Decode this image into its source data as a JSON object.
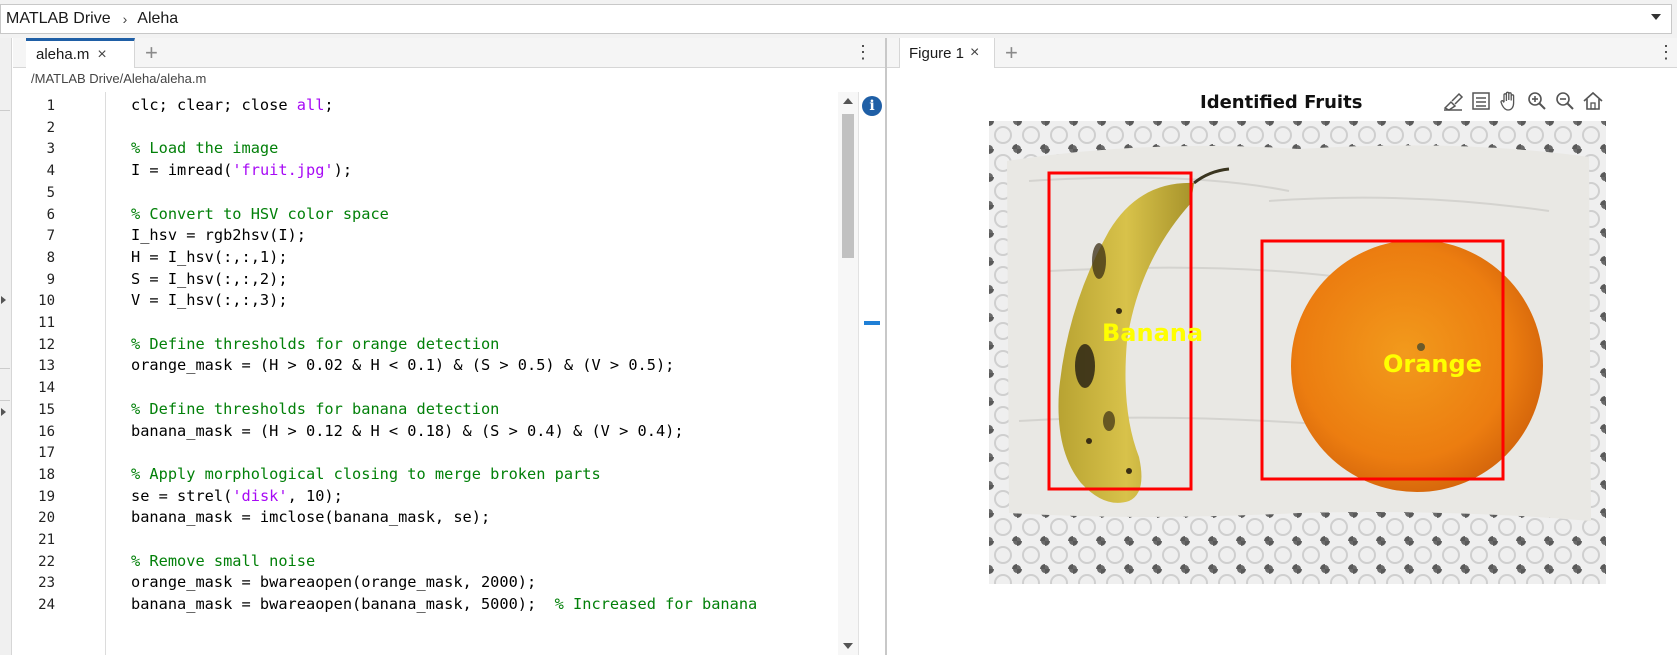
{
  "address_bar": {
    "segments": [
      "MATLAB Drive",
      "Aleha"
    ],
    "separator": "›"
  },
  "editor": {
    "tab_label": "aleha.m",
    "file_path": "/MATLAB Drive/Aleha/aleha.m",
    "line_numbers": [
      "1",
      "2",
      "3",
      "4",
      "5",
      "6",
      "7",
      "8",
      "9",
      "10",
      "11",
      "12",
      "13",
      "14",
      "15",
      "16",
      "17",
      "18",
      "19",
      "20",
      "21",
      "22",
      "23",
      "24"
    ],
    "lines": [
      [
        {
          "t": "clc; clear; close ",
          "c": ""
        },
        {
          "t": "all",
          "c": "kw"
        },
        {
          "t": ";",
          "c": ""
        }
      ],
      [],
      [
        {
          "t": "% Load the image",
          "c": "cm"
        }
      ],
      [
        {
          "t": "I = imread(",
          "c": ""
        },
        {
          "t": "'fruit.jpg'",
          "c": "str"
        },
        {
          "t": ");",
          "c": ""
        }
      ],
      [],
      [
        {
          "t": "% Convert to HSV color space",
          "c": "cm"
        }
      ],
      [
        {
          "t": "I_hsv = rgb2hsv(I);",
          "c": ""
        }
      ],
      [
        {
          "t": "H = I_hsv(:,:,1);",
          "c": ""
        }
      ],
      [
        {
          "t": "S = I_hsv(:,:,2);",
          "c": ""
        }
      ],
      [
        {
          "t": "V = I_hsv(:,:,3);",
          "c": ""
        }
      ],
      [],
      [
        {
          "t": "% Define thresholds for orange detection",
          "c": "cm"
        }
      ],
      [
        {
          "t": "orange_mask = (H > 0.02 & H < 0.1) & (S > 0.5) & (V > 0.5);",
          "c": ""
        }
      ],
      [],
      [
        {
          "t": "% Define thresholds for banana detection",
          "c": "cm"
        }
      ],
      [
        {
          "t": "banana_mask = (H > 0.12 & H < 0.18) & (S > 0.4) & (V > 0.4);",
          "c": ""
        }
      ],
      [],
      [
        {
          "t": "% Apply morphological closing to merge broken parts",
          "c": "cm"
        }
      ],
      [
        {
          "t": "se = strel(",
          "c": ""
        },
        {
          "t": "'disk'",
          "c": "str"
        },
        {
          "t": ", 10);",
          "c": ""
        }
      ],
      [
        {
          "t": "banana_mask = imclose(banana_mask, se);",
          "c": ""
        }
      ],
      [],
      [
        {
          "t": "% Remove small noise",
          "c": "cm"
        }
      ],
      [
        {
          "t": "orange_mask = bwareaopen(orange_mask, 2000);",
          "c": ""
        }
      ],
      [
        {
          "t": "banana_mask = bwareaopen(banana_mask, 5000);  ",
          "c": ""
        },
        {
          "t": "% Increased for banana",
          "c": "cm"
        }
      ]
    ]
  },
  "figure": {
    "tab_label": "Figure 1",
    "title": "Identified Fruits",
    "toolbar_icons": [
      "brush-icon",
      "legend-icon",
      "pan-hand-icon",
      "zoom-in-icon",
      "zoom-out-icon",
      "home-icon"
    ],
    "labels": {
      "banana": "Banana",
      "orange": "Orange"
    },
    "box_color": "#ff0000",
    "label_color": "#ffff00"
  },
  "icons": {
    "close": "×",
    "add": "+",
    "more": "⋮",
    "info": "i"
  }
}
